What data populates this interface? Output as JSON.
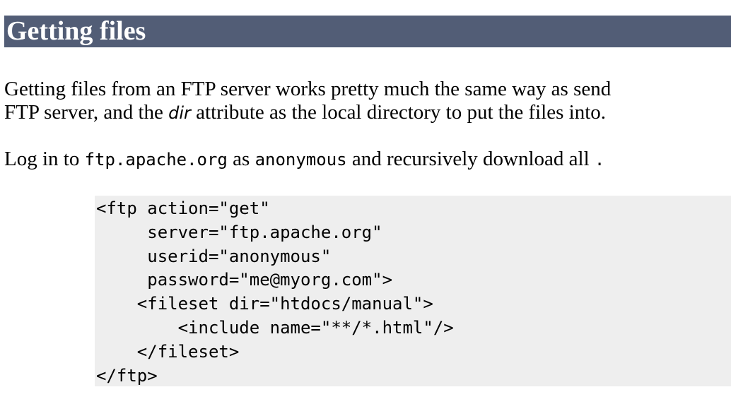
{
  "section": {
    "heading": "Getting files"
  },
  "intro": {
    "line1": "Getting files from an FTP server works pretty much the same way as send",
    "line2_before": "FTP server, and the ",
    "line2_em": "dir",
    "line2_after": " attribute as the local directory to put the files into."
  },
  "example": {
    "t1": "Log in to ",
    "c1": "ftp.apache.org",
    "t2": " as ",
    "c2": "anonymous",
    "t3": " and recursively download all ",
    "c3": "."
  },
  "code": {
    "lines": [
      "<ftp action=\"get\"",
      "     server=\"ftp.apache.org\"",
      "     userid=\"anonymous\"",
      "     password=\"me@myorg.com\">",
      "    <fileset dir=\"htdocs/manual\">",
      "        <include name=\"**/*.html\"/>",
      "    </fileset>",
      "</ftp>"
    ]
  }
}
